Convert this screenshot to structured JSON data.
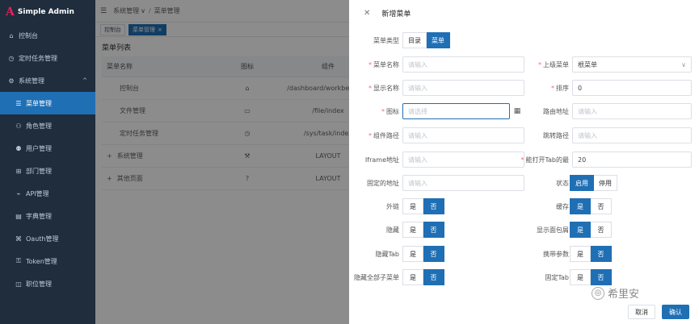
{
  "brand": {
    "logo": "A",
    "title": "Simple Admin"
  },
  "sidebar": {
    "items": [
      {
        "label": "控制台",
        "icon": "⌂"
      },
      {
        "label": "定时任务管理",
        "icon": "◷"
      },
      {
        "label": "系统管理",
        "icon": "⚙",
        "caret": "^"
      },
      {
        "label": "菜单管理",
        "icon": "☰"
      },
      {
        "label": "角色管理",
        "icon": "⚇"
      },
      {
        "label": "用户管理",
        "icon": "⚉"
      },
      {
        "label": "部门管理",
        "icon": "⊞"
      },
      {
        "label": "API管理",
        "icon": "⌁"
      },
      {
        "label": "字典管理",
        "icon": "▤"
      },
      {
        "label": "Oauth管理",
        "icon": "⌘"
      },
      {
        "label": "Token管理",
        "icon": "⚿"
      },
      {
        "label": "职位管理",
        "icon": "◫"
      }
    ]
  },
  "topbar": {
    "crumb1": "系统管理",
    "crumb1_caret": "∨",
    "sep": "/",
    "crumb2": "菜单管理"
  },
  "tabs": [
    {
      "label": "控制台"
    },
    {
      "label": "菜单管理",
      "close": "×"
    }
  ],
  "panel": {
    "title": "菜单列表"
  },
  "table": {
    "headers": [
      "菜单名称",
      "图标",
      "组件"
    ],
    "rows": [
      {
        "name": "控制台",
        "icon": "⌂",
        "comp": "/dashboard/workbench/in"
      },
      {
        "name": "文件管理",
        "icon": "▭",
        "comp": "/file/index"
      },
      {
        "name": "定时任务管理",
        "icon": "◷",
        "comp": "/sys/task/index"
      },
      {
        "name": "系统管理",
        "icon": "⚒",
        "comp": "LAYOUT",
        "expand": "+"
      },
      {
        "name": "其他页面",
        "icon": "?",
        "comp": "LAYOUT",
        "expand": "+"
      }
    ]
  },
  "drawer": {
    "close": "✕",
    "title": "新增菜单",
    "menu_type": {
      "label": "菜单类型",
      "options": [
        "目录",
        "菜单"
      ]
    },
    "menu_name": {
      "label": "菜单名称",
      "placeholder": "请输入"
    },
    "parent_menu": {
      "label": "上级菜单",
      "value": "根菜单",
      "chevron": "∨"
    },
    "display_name": {
      "label": "显示名称",
      "placeholder": "请输入"
    },
    "sort": {
      "label": "排序",
      "value": "0"
    },
    "icon": {
      "label": "图标",
      "placeholder": "请选择",
      "grid": "▦"
    },
    "route_path": {
      "label": "路由地址",
      "placeholder": "请输入"
    },
    "component_path": {
      "label": "组件路径",
      "placeholder": "请输入"
    },
    "redirect_path": {
      "label": "跳转路径",
      "placeholder": "请输入"
    },
    "iframe": {
      "label": "Iframe地址",
      "placeholder": "请输入"
    },
    "max_tabs": {
      "label": "能打开Tab的最",
      "value": "20"
    },
    "fixed_addr": {
      "label": "固定的地址",
      "placeholder": "请输入"
    },
    "status": {
      "label": "状态",
      "options": [
        "启用",
        "停用"
      ]
    },
    "external": {
      "label": "外链",
      "options": [
        "是",
        "否"
      ]
    },
    "cache": {
      "label": "缓存",
      "options": [
        "是",
        "否"
      ]
    },
    "hidden": {
      "label": "隐藏",
      "options": [
        "是",
        "否"
      ]
    },
    "show_breadcrumb": {
      "label": "显示面包屑",
      "options": [
        "是",
        "否"
      ]
    },
    "hide_tab": {
      "label": "隐藏Tab",
      "options": [
        "是",
        "否"
      ]
    },
    "carry_params": {
      "label": "携带参数",
      "options": [
        "是",
        "否"
      ]
    },
    "hide_children": {
      "label": "隐藏全部子菜单",
      "options": [
        "是",
        "否"
      ]
    },
    "fixed_tab": {
      "label": "固定Tab",
      "options": [
        "是",
        "否"
      ]
    },
    "cancel": "取消",
    "confirm": "确认"
  },
  "watermark": {
    "text": "希里安"
  },
  "colors": {
    "primary": "#1f6fb5",
    "sidebar": "#1f2d3d"
  }
}
